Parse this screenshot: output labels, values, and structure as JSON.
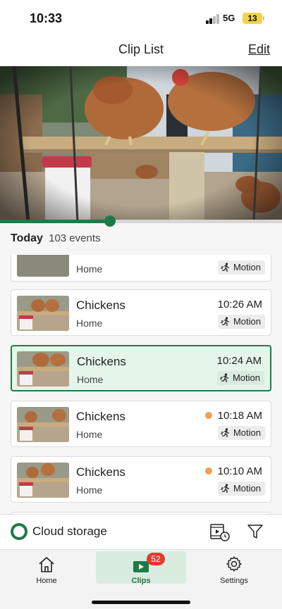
{
  "status_bar": {
    "time": "10:33",
    "network": "5G",
    "battery": "13"
  },
  "nav": {
    "title": "Clip List",
    "edit_label": "Edit"
  },
  "player": {
    "progress_fraction": 0.39
  },
  "list_header": {
    "day": "Today",
    "count": "103 events"
  },
  "clips": [
    {
      "title": "",
      "camera": "Home",
      "time": "",
      "tag": "Motion",
      "alert": false,
      "selected": false
    },
    {
      "title": "Chickens",
      "camera": "Home",
      "time": "10:26 AM",
      "tag": "Motion",
      "alert": false,
      "selected": false
    },
    {
      "title": "Chickens",
      "camera": "Home",
      "time": "10:24 AM",
      "tag": "Motion",
      "alert": false,
      "selected": true
    },
    {
      "title": "Chickens",
      "camera": "Home",
      "time": "10:18 AM",
      "tag": "Motion",
      "alert": true,
      "selected": false
    },
    {
      "title": "Chickens",
      "camera": "Home",
      "time": "10:10 AM",
      "tag": "Motion",
      "alert": true,
      "selected": false
    }
  ],
  "storage": {
    "label": "Cloud storage"
  },
  "tabs": [
    {
      "label": "Home",
      "icon": "house-icon",
      "active": false
    },
    {
      "label": "Clips",
      "icon": "play-icon",
      "active": true,
      "badge": "52"
    },
    {
      "label": "Settings",
      "icon": "gear-icon",
      "active": false
    }
  ],
  "colors": {
    "accent": "#1e7a4a",
    "alert_dot": "#f0a050",
    "badge_red": "#e23b30",
    "selected_bg": "#e4f5ea"
  }
}
